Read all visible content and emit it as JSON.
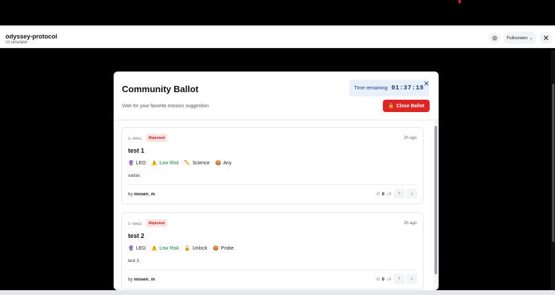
{
  "app": {
    "title": "odyssey-protocol",
    "subtitle": "UI simulator"
  },
  "toolbar": {
    "fullscreen_label": "Fullscreen",
    "theme_icon": "sun-icon",
    "close_icon": "close-icon"
  },
  "modal": {
    "title": "Community Ballot",
    "subtitle": "Vote for your favorite mission suggestion",
    "timer_label": "Time remaining:",
    "timer_value": "01:37:18",
    "close_ballot_label": "Close Ballot"
  },
  "suggestions": [
    {
      "id": "S-0001",
      "status": "Rejected",
      "time": "2h ago",
      "title": "test 1",
      "orbit": "LEO",
      "risk": "Low Risk",
      "category": "Science",
      "target": "Any",
      "description": "sadas",
      "author_prefix": "by",
      "author": "mosen_m",
      "up": "↑0",
      "score": "0",
      "down": "↓0"
    },
    {
      "id": "S-0002",
      "status": "Rejected",
      "time": "2h ago",
      "title": "test 2",
      "orbit": "LEO",
      "risk": "Low Risk",
      "category": "Unlock",
      "target": "Probe",
      "description": "test 3",
      "author_prefix": "by",
      "author": "mosen_m",
      "up": "↑0",
      "score": "0",
      "down": "↓0"
    }
  ]
}
